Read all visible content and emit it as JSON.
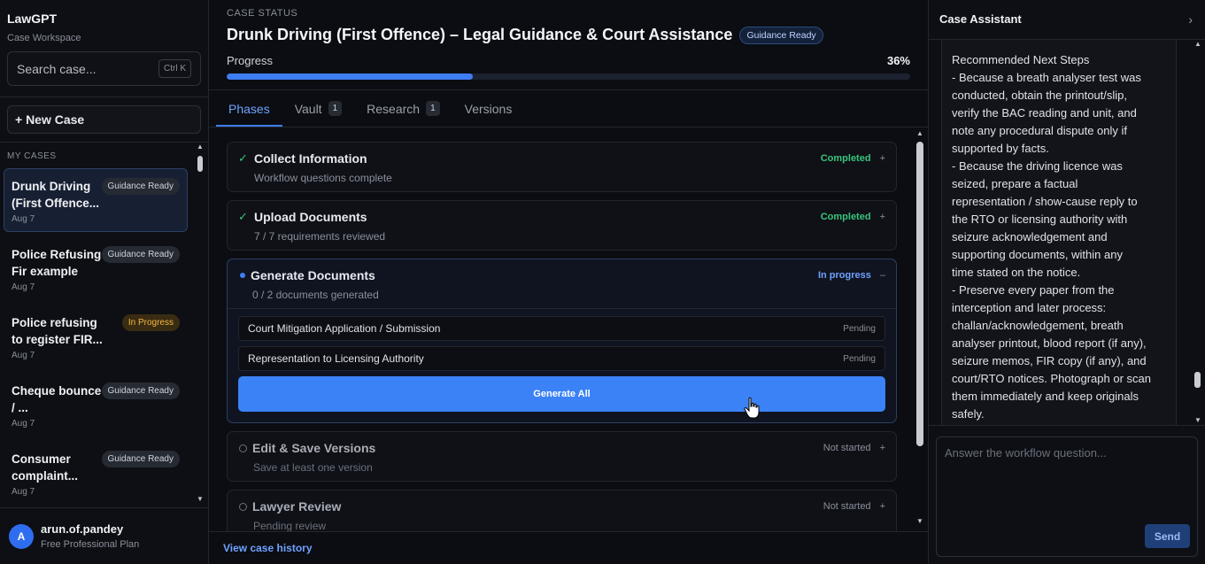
{
  "sidebar": {
    "brand": "LawGPT",
    "subtitle": "Case Workspace",
    "search_placeholder": "Search case...",
    "search_shortcut": "Ctrl K",
    "new_case_label": "+ New Case",
    "cases_header": "MY CASES",
    "cases": [
      {
        "name": "Drunk Driving (First Offence...",
        "date": "Aug 7",
        "badge": "Guidance Ready"
      },
      {
        "name": "Police Refusing Fir example",
        "date": "Aug 7",
        "badge": "Guidance Ready"
      },
      {
        "name": "Police refusing to register FIR...",
        "date": "Aug 7",
        "badge": "In Progress"
      },
      {
        "name": "Cheque bounce / ...",
        "date": "Aug 7",
        "badge": "Guidance Ready"
      },
      {
        "name": "Consumer complaint...",
        "date": "Aug 7",
        "badge": "Guidance Ready"
      }
    ],
    "user": {
      "initial": "A",
      "name": "arun.of.pandey",
      "plan": "Free Professional Plan"
    }
  },
  "main": {
    "status_label": "CASE STATUS",
    "title": "Drunk Driving (First Offence) – Legal Guidance & Court Assistance",
    "title_badge": "Guidance Ready",
    "progress_label": "Progress",
    "progress_value": "36%",
    "progress_fraction": 0.36,
    "tabs": [
      {
        "label": "Phases",
        "count": ""
      },
      {
        "label": "Vault",
        "count": "1"
      },
      {
        "label": "Research",
        "count": "1"
      },
      {
        "label": "Versions",
        "count": ""
      }
    ],
    "phases": [
      {
        "title": "Collect Information",
        "sub": "Workflow questions complete",
        "status": "Completed",
        "toggle": "+"
      },
      {
        "title": "Upload Documents",
        "sub": "7 / 7 requirements reviewed",
        "status": "Completed",
        "toggle": "+"
      },
      {
        "title": "Generate Documents",
        "sub": "0 / 2 documents generated",
        "status": "In progress",
        "toggle": "–"
      },
      {
        "title": "Edit & Save Versions",
        "sub": "Save at least one version",
        "status": "Not started",
        "toggle": "+"
      },
      {
        "title": "Lawyer Review",
        "sub": "Pending review",
        "status": "Not started",
        "toggle": "+"
      }
    ],
    "documents": [
      {
        "name": "Court Mitigation Application / Submission",
        "status": "Pending"
      },
      {
        "name": "Representation to Licensing Authority",
        "status": "Pending"
      }
    ],
    "generate_label": "Generate All",
    "history_link": "View case history"
  },
  "assistant": {
    "title": "Case Assistant",
    "lines": [
      "Recommended Next Steps",
      "- Because a breath analyser test was",
      "conducted, obtain the printout/slip,",
      "verify the BAC reading and unit, and",
      "note any procedural dispute only if",
      "supported by facts.",
      "- Because the driving licence was",
      "seized, prepare a factual",
      "representation / show-cause reply to",
      "the RTO or licensing authority with",
      "seizure acknowledgement and",
      "supporting documents, within any",
      "time stated on the notice.",
      "- Preserve every paper from the",
      "interception and later process:",
      "challan/acknowledgement, breath",
      "analyser printout, blood report (if any),",
      "seizure memos, FIR copy (if any), and",
      "court/RTO notices. Photograph or scan",
      "them immediately and keep originals",
      "safely."
    ],
    "input_placeholder": "Answer the workflow question...",
    "send_label": "Send"
  }
}
